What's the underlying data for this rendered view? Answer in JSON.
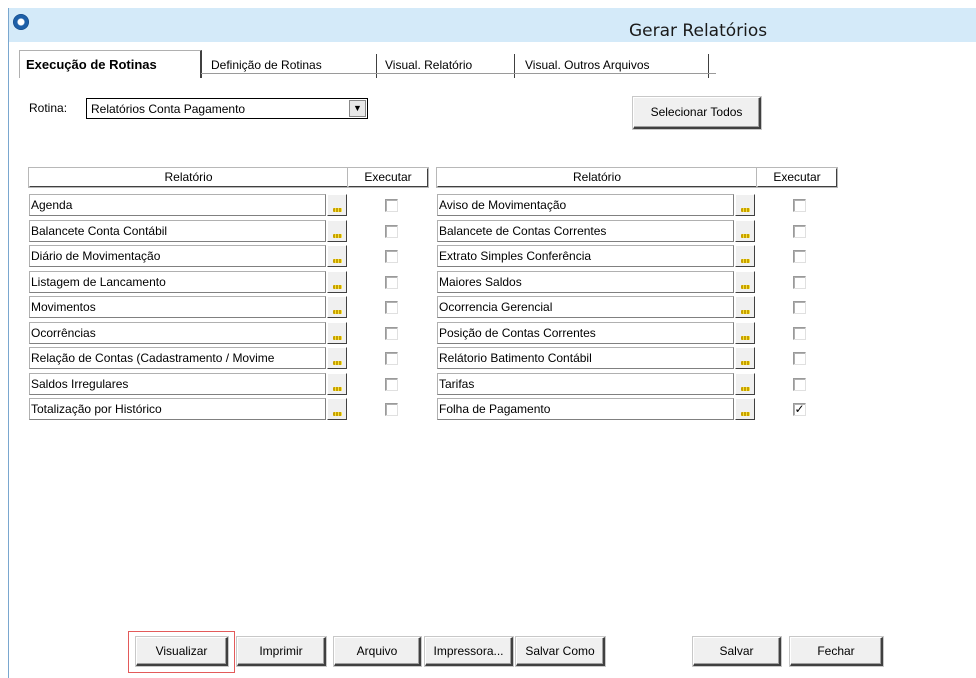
{
  "window": {
    "title": "Gerar Relatórios"
  },
  "tabs": [
    {
      "label": "Execução de Rotinas",
      "active": true
    },
    {
      "label": "Definição de Rotinas",
      "active": false
    },
    {
      "label": "Visual. Relatório",
      "active": false
    },
    {
      "label": "Visual. Outros Arquivos",
      "active": false
    }
  ],
  "rotina": {
    "label": "Rotina:",
    "value": "Relatórios Conta Pagamento"
  },
  "select_all_label": "Selecionar Todos",
  "grid": {
    "col_relatorio": "Relatório",
    "col_executar": "Executar",
    "left": [
      {
        "name": "Agenda",
        "checked": false
      },
      {
        "name": "Balancete Conta Contábil",
        "checked": false
      },
      {
        "name": "Diário de Movimentação",
        "checked": false
      },
      {
        "name": "Listagem de Lancamento",
        "checked": false
      },
      {
        "name": "Movimentos",
        "checked": false
      },
      {
        "name": "Ocorrências",
        "checked": false
      },
      {
        "name": "Relação de Contas (Cadastramento / Movime",
        "checked": false
      },
      {
        "name": "Saldos Irregulares",
        "checked": false
      },
      {
        "name": "Totalização por Histórico",
        "checked": false
      }
    ],
    "right": [
      {
        "name": "Aviso de Movimentação",
        "checked": false
      },
      {
        "name": "Balancete de Contas Correntes",
        "checked": false
      },
      {
        "name": "Extrato Simples Conferência",
        "checked": false
      },
      {
        "name": "Maiores Saldos",
        "checked": false
      },
      {
        "name": "Ocorrencia Gerencial",
        "checked": false
      },
      {
        "name": "Posição de Contas Correntes",
        "checked": false
      },
      {
        "name": "Relátorio Batimento Contábil",
        "checked": false
      },
      {
        "name": "Tarifas",
        "checked": false
      },
      {
        "name": "Folha de Pagamento",
        "checked": true
      }
    ]
  },
  "buttons": {
    "visualizar": "Visualizar",
    "imprimir": "Imprimir",
    "arquivo": "Arquivo",
    "impressora": "Impressora...",
    "salvar_como": "Salvar Como",
    "salvar": "Salvar",
    "fechar": "Fechar"
  },
  "colors": {
    "titlebar": "#d4eaf9",
    "highlight": "#e35a5a"
  }
}
